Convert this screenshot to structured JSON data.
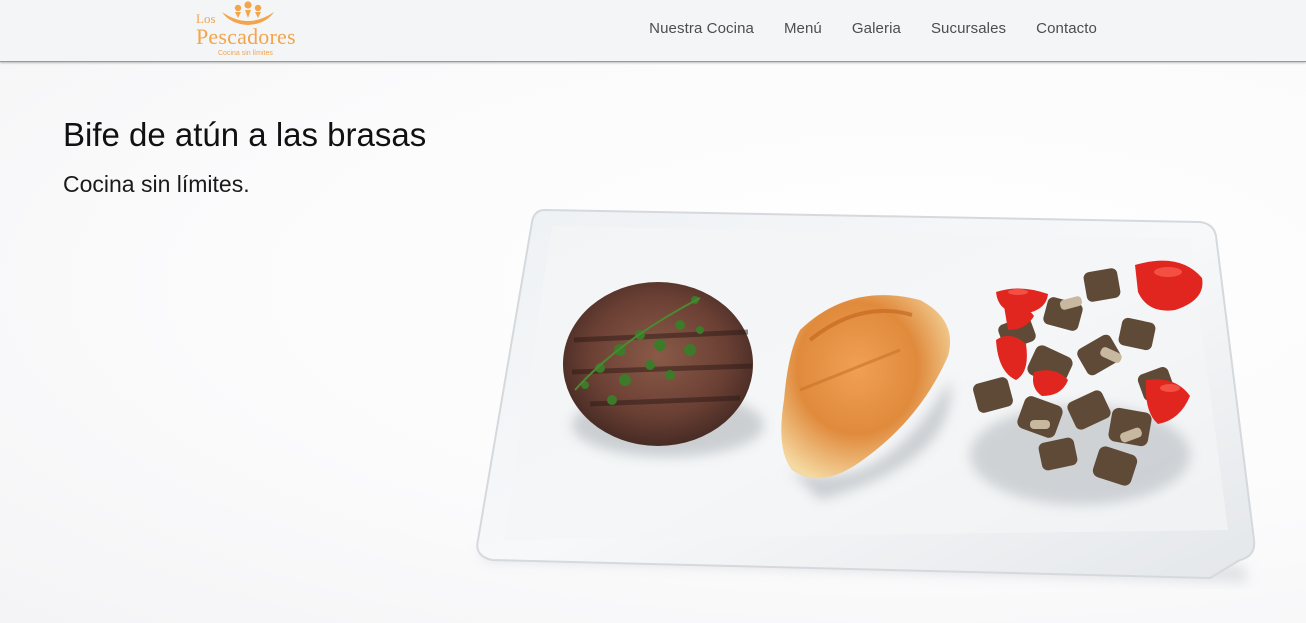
{
  "brand": {
    "line1": "Los",
    "line2": "Pescadores",
    "tagline": "Cocina sin límites",
    "color": "#f2a54a"
  },
  "nav": {
    "items": [
      "Nuestra Cocina",
      "Menú",
      "Galeria",
      "Sucursales",
      "Contacto"
    ]
  },
  "hero": {
    "title": "Bife de atún a las brasas",
    "subtitle": "Cocina sin límites."
  },
  "icons": [
    "crown-logo-icon"
  ]
}
